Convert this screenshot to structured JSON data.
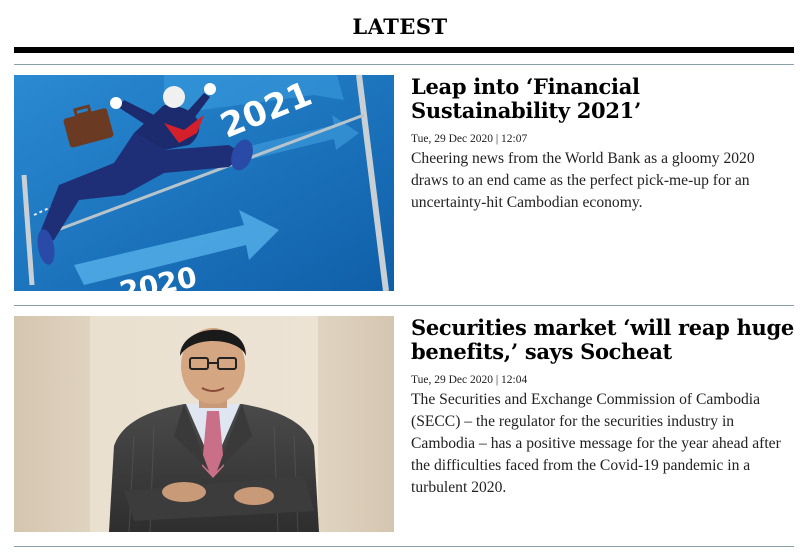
{
  "section": {
    "title": "LATEST"
  },
  "articles": [
    {
      "headline": "Leap into ‘Financial Sustainability 2021’",
      "meta": "Tue, 29 Dec 2020 | 12:07",
      "summary": "Cheering news from the World Bank as a gloomy 2020 draws to an end came as the perfect pick-me-up for an uncertainty-hit Cambodian economy.",
      "image": {
        "year_top": "2021",
        "year_bottom": "2020"
      }
    },
    {
      "headline": "Securities market ‘will reap huge benefits,’ says Socheat",
      "meta": "Tue, 29 Dec 2020 | 12:04",
      "summary": "The Securities and Exchange Commission of Cambodia (SECC) – the regulator for the securities industry in Cambodia – has a positive message for the year ahead after the difficulties faced from the Covid-19 pandemic in a turbulent 2020."
    }
  ],
  "colors": {
    "rule": "#000000",
    "divider": "#8aa0a8",
    "illustration_bg": "#1a78c2"
  }
}
